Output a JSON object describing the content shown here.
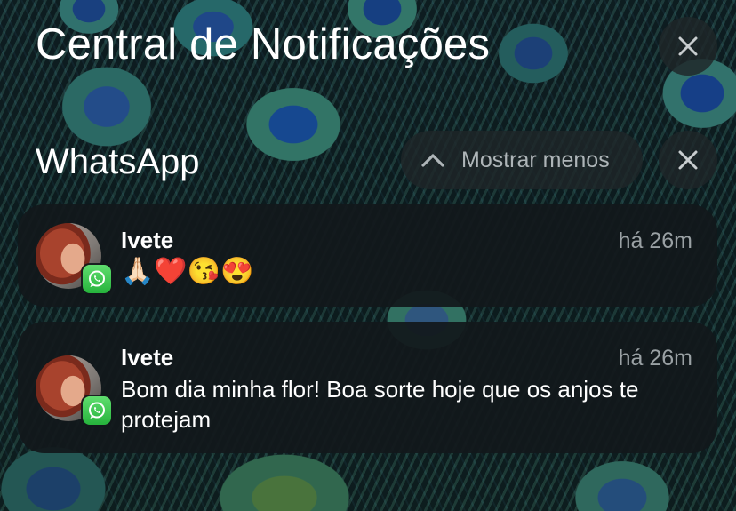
{
  "header": {
    "title": "Central de Notificações",
    "close_all_icon": "close-icon"
  },
  "group": {
    "app_name": "WhatsApp",
    "show_less_label": "Mostrar menos",
    "show_less_icon": "chevron-up-icon",
    "clear_icon": "close-icon"
  },
  "notifications": [
    {
      "sender": "Ivete",
      "time": "há 26m",
      "message": "🙏🏻❤️😘😍",
      "app_icon": "whatsapp-icon"
    },
    {
      "sender": "Ivete",
      "time": "há 26m",
      "message": "Bom dia minha flor! Boa sorte hoje que os anjos te protejam",
      "app_icon": "whatsapp-icon"
    }
  ],
  "colors": {
    "card_background": "#12181b",
    "secondary_text": "#9aa1a4",
    "whatsapp_green": "#26b33c"
  }
}
